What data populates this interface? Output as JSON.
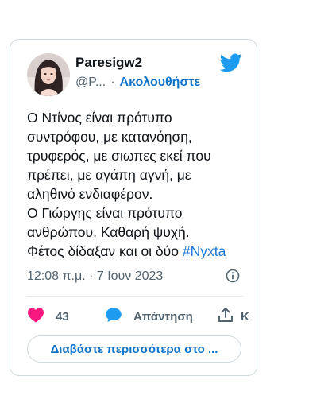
{
  "tweet": {
    "author": {
      "display_name": "Paresigw2",
      "handle": "@P...",
      "separator": "·",
      "follow_label": "Ακολουθήστε"
    },
    "text_lines": [
      "Ο Ντίνος είναι πρότυπο",
      "συντρόφου, με κατανόηση,",
      "τρυφερός, με σιωπες εκεί που",
      "πρέπει, με αγάπη αγνή, με",
      "αληθινό ενδιαφέρον.",
      "Ο Γιώργης είναι πρότυπο",
      "ανθρώπου. Καθαρή ψυχή."
    ],
    "last_line_text": "Φέτος δίδαξαν και οι δύο",
    "hashtag": "#Nyxta",
    "timestamp": "12:08 π.μ. · 7 Ιουν 2023",
    "actions": {
      "like_count": "43",
      "reply_label": "Απάντηση",
      "share_label": "Κ"
    },
    "read_more_label": "Διαβάστε περισσότερα στο ..."
  },
  "colors": {
    "accent": "#0f73c9",
    "twitter_blue": "#1d9bf0",
    "like": "#f91880",
    "muted_text": "#536471",
    "border": "#cfd9de"
  },
  "icons": [
    "twitter-bird-icon",
    "info-icon",
    "heart-icon",
    "reply-bubble-icon",
    "share-icon"
  ]
}
